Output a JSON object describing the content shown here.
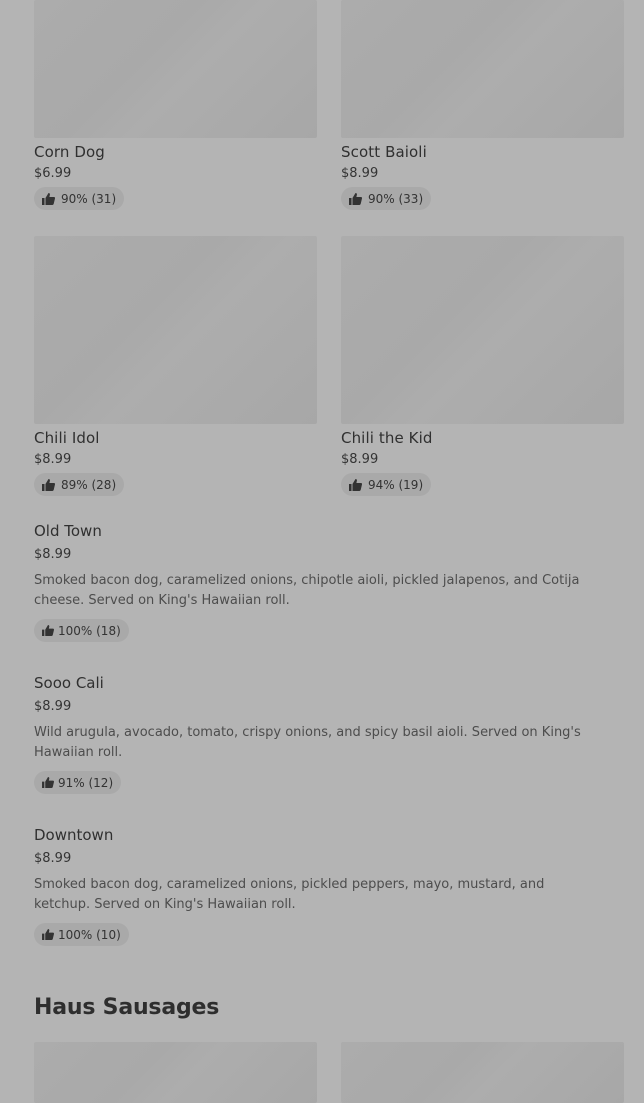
{
  "grid_items": [
    {
      "name": "Corn Dog",
      "price": "$6.99",
      "rating": "90% (31)"
    },
    {
      "name": "Scott Baioli",
      "price": "$8.99",
      "rating": "90% (33)"
    },
    {
      "name": "Chili Idol",
      "price": "$8.99",
      "rating": "89% (28)"
    },
    {
      "name": "Chili the Kid",
      "price": "$8.99",
      "rating": "94% (19)"
    }
  ],
  "list_items": [
    {
      "name": "Old Town",
      "price": "$8.99",
      "description": "Smoked bacon dog, caramelized onions, chipotle aioli, pickled jalapenos, and Cotija cheese. Served on King's Hawaiian roll.",
      "rating": "100% (18)"
    },
    {
      "name": "Sooo Cali",
      "price": "$8.99",
      "description": "Wild arugula, avocado, tomato, crispy onions, and spicy basil aioli. Served on King's Hawaiian roll.",
      "rating": "91% (12)"
    },
    {
      "name": "Downtown",
      "price": "$8.99",
      "description": "Smoked bacon dog, caramelized onions, pickled peppers, mayo, mustard, and ketchup. Served on King's Hawaiian roll.",
      "rating": "100% (10)"
    }
  ],
  "section": {
    "title": "Haus Sausages"
  },
  "icons": {
    "rating": "thumbs-up-icon"
  }
}
